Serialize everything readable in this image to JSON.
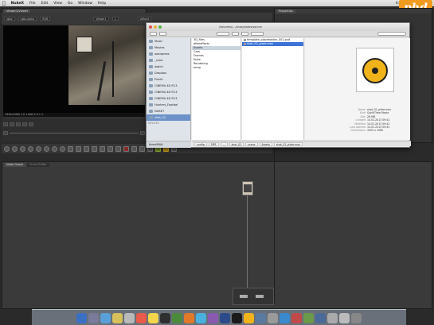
{
  "menubar": {
    "apple": "",
    "items": [
      "NukeX",
      "File",
      "Edit",
      "View",
      "Go",
      "Window",
      "Help"
    ],
    "clock": "4:13 PM"
  },
  "brand": {
    "text": "phd"
  },
  "viewer": {
    "tabs": [
      "Viewer1/Viewer"
    ],
    "controls": [
      "rgba",
      "rgba.alpha",
      "RGB",
      "Viewer1",
      "1",
      "default"
    ],
    "info": "1920x1080  1.0  1.000  0 0 1 1"
  },
  "properties": {
    "tabs": [
      "Properties"
    ]
  },
  "nodegraph": {
    "tabs": [
      "Node Graph",
      "Curve Editor"
    ]
  },
  "dialog": {
    "title": "/Volumes/.../shot/plates/source",
    "sidebar": {
      "devices_head": "DEVICES",
      "items": [
        {
          "label": "Music"
        },
        {
          "label": "Movies"
        },
        {
          "label": "wordpress"
        },
        {
          "label": "_nuke"
        },
        {
          "label": "watch"
        },
        {
          "label": "Dropbox"
        },
        {
          "label": "Public"
        },
        {
          "label": "CINEMA 4D R13"
        },
        {
          "label": "CINEMA 4D R13"
        },
        {
          "label": "CINEMA 4D R13"
        },
        {
          "label": "Hunters_Footbal"
        },
        {
          "label": "NUKE7"
        },
        {
          "label": "shot_02",
          "selected": true
        }
      ],
      "bottom": "KernelMAN"
    },
    "column1": [
      {
        "label": "3D_files"
      },
      {
        "label": "aftereffects"
      },
      {
        "label": "Assets",
        "selected": true
      },
      {
        "label": "Cam"
      },
      {
        "label": "Frames"
      },
      {
        "label": "Nuke"
      },
      {
        "label": "Rendering"
      },
      {
        "label": "temp"
      }
    ],
    "column2": [
      {
        "label": "template_placeholder_001.psd"
      },
      {
        "label": "shot_02_plate.mov",
        "highlighted": true
      }
    ],
    "preview": {
      "meta": [
        {
          "k": "Name",
          "v": "shot_02_plate.mov"
        },
        {
          "k": "Kind",
          "v": "QuickTime Movie"
        },
        {
          "k": "Size",
          "v": "28 MB"
        },
        {
          "k": "Created",
          "v": "14.01.2013 09:41"
        },
        {
          "k": "Modified",
          "v": "14.01.2013 09:41"
        },
        {
          "k": "Last opened",
          "v": "14.01.2013 09:41"
        },
        {
          "k": "Dimensions",
          "v": "1920 x 1080"
        }
      ]
    },
    "pathbar": [
      "config",
      "PIPE",
      "...",
      "shot_02",
      "scene",
      "Assets",
      "shot_02_plate.mov"
    ]
  },
  "colors": {
    "brand": "#f29a1f",
    "selection": "#3b74d6"
  }
}
